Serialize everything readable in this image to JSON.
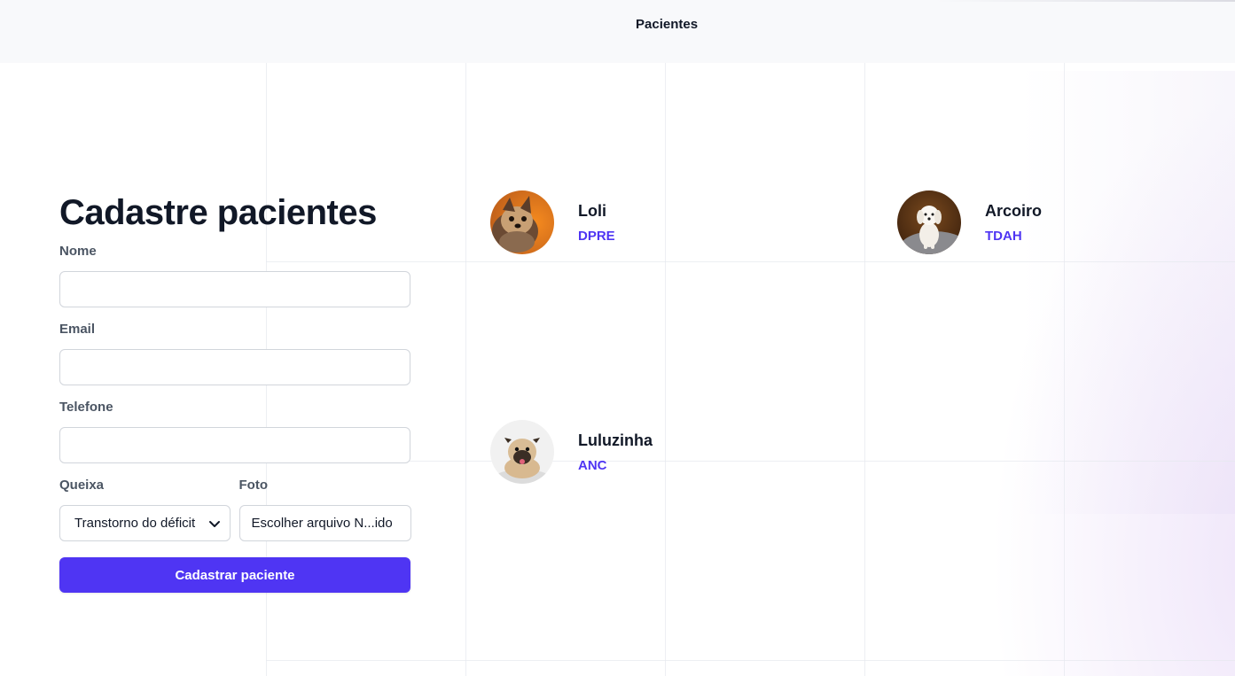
{
  "nav": {
    "links": [
      {
        "label": "Pacientes"
      }
    ]
  },
  "form": {
    "title": "Cadastre pacientes",
    "fields": {
      "nome": {
        "label": "Nome",
        "value": ""
      },
      "email": {
        "label": "Email",
        "value": ""
      },
      "telefone": {
        "label": "Telefone",
        "value": ""
      },
      "queixa": {
        "label": "Queixa",
        "selected": "Transtorno do déficit"
      },
      "foto": {
        "label": "Foto",
        "value": "Escolher arquivo N...ido"
      }
    },
    "submit_label": "Cadastrar paciente"
  },
  "patients": [
    {
      "name": "Loli",
      "tag": "DPRE",
      "avatar_icon": "dog-photo-yorkshire"
    },
    {
      "name": "Arcoiro",
      "tag": "TDAH",
      "avatar_icon": "dog-photo-maltese"
    },
    {
      "name": "Luluzinha",
      "tag": "ANC",
      "avatar_icon": "dog-photo-pug"
    }
  ],
  "colors": {
    "accent": "#4f35f3",
    "text": "#111827",
    "label": "#4b5563",
    "nav_bg": "#f8f9fb"
  }
}
